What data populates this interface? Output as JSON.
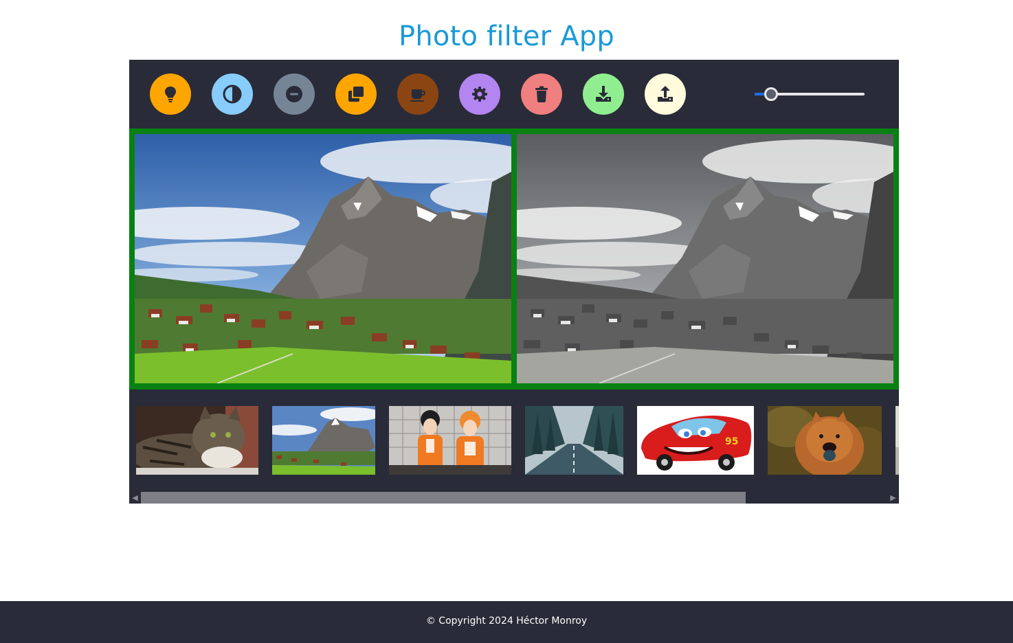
{
  "app": {
    "title": "Photo filter App"
  },
  "toolbar": {
    "buttons": [
      {
        "id": "brightness",
        "icon": "lightbulb-icon",
        "color": "#ffa500"
      },
      {
        "id": "contrast",
        "icon": "contrast-icon",
        "color": "#87ccfa"
      },
      {
        "id": "grayscale",
        "icon": "minus-circle-icon",
        "color": "#758596"
      },
      {
        "id": "copy",
        "icon": "copy-icon",
        "color": "#ffa500"
      },
      {
        "id": "sepia",
        "icon": "coffee-cup-icon",
        "color": "#8b4513"
      },
      {
        "id": "settings",
        "icon": "gear-icon",
        "color": "#b285f0"
      },
      {
        "id": "delete",
        "icon": "trash-icon",
        "color": "#f07f7f"
      },
      {
        "id": "download",
        "icon": "download-icon",
        "color": "#90ee90"
      },
      {
        "id": "upload",
        "icon": "upload-icon",
        "color": "#fffbdc"
      }
    ],
    "slider": {
      "value": 0.15,
      "color": "#1e6be6"
    }
  },
  "preview": {
    "border_color": "#088112"
  },
  "gallery": {
    "thumbnails": [
      "cat",
      "mountain",
      "anime-volleyball",
      "forest-road",
      "race-car",
      "chow-chow-dog",
      "partial"
    ]
  },
  "footer": {
    "copyright": "© Copyright 2024 Héctor Monroy"
  }
}
